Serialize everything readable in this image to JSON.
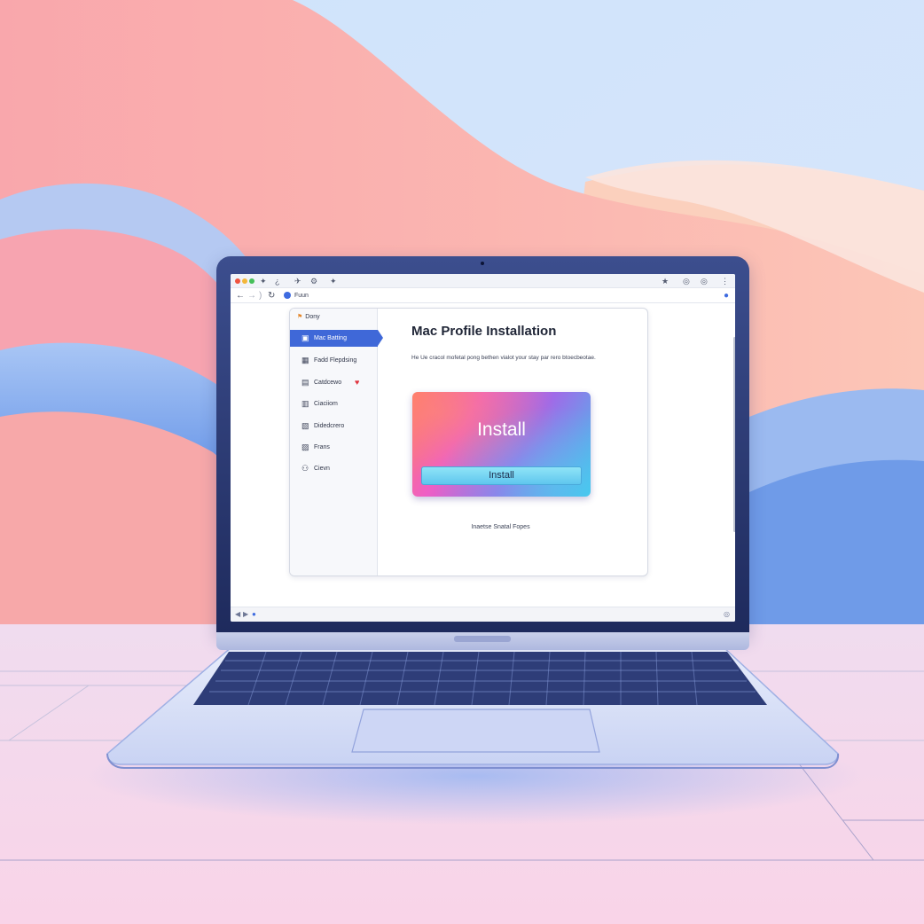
{
  "browser": {
    "tab_icons": [
      "✦",
      "¿",
      "✈",
      "⚙",
      "✦"
    ],
    "toolbar_right_icons": [
      "★",
      "◎",
      "◎",
      "⋮"
    ],
    "nav": {
      "back": "←",
      "forward": "→",
      "separator": ")",
      "reload": "↻"
    },
    "url_text": "Fuun",
    "url_icon": "site-icon",
    "status_left": [
      "◀",
      "▶",
      "●"
    ],
    "status_right": "◎"
  },
  "sidebar": {
    "header": "Dony",
    "items": [
      {
        "icon": "▣",
        "label": "Mac Batting",
        "active": true
      },
      {
        "icon": "▦",
        "label": "Fadd Flepdsing",
        "active": false
      },
      {
        "icon": "▤",
        "label": "Catdcewo",
        "active": false,
        "badge": "♥"
      },
      {
        "icon": "▥",
        "label": "Ciaciiom",
        "active": false
      },
      {
        "icon": "▧",
        "label": "Didedcrero",
        "active": false
      },
      {
        "icon": "▨",
        "label": "Frans",
        "active": false
      },
      {
        "icon": "⚇",
        "label": "Cievn",
        "active": false
      }
    ]
  },
  "main": {
    "title": "Mac Profile Installation",
    "description": "He Ue cracol mofetal pong bethen vialot your stay par rero btoecbeotae.",
    "install_card": {
      "heading": "Install",
      "button_label": "Install"
    },
    "note": "Inaetse Snatal Fopes"
  },
  "colors": {
    "accent": "#3f68d8",
    "heart": "#e0353f",
    "install_button": "#6fd0f2"
  }
}
